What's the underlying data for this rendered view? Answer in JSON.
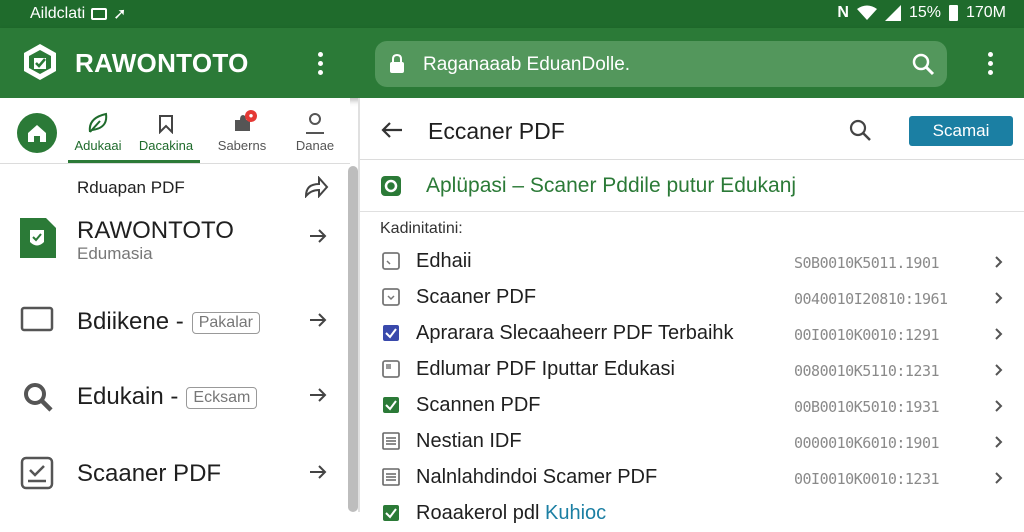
{
  "status_bar": {
    "left_text": "Aildclati",
    "battery": "15%",
    "time": "170M"
  },
  "app_bar": {
    "title": "RAWONTOTO",
    "search_text": "Raganaaab EduanDolle."
  },
  "left_panel": {
    "tabs": [
      {
        "label": "Adukaai",
        "active": true
      },
      {
        "label": "Dacakina",
        "active": true
      },
      {
        "label": "Saberns",
        "active": false
      },
      {
        "label": "Danae",
        "active": false
      }
    ],
    "list_header": "Rduapan PDF",
    "items": [
      {
        "title": "RAWONTOTO",
        "subtitle": "Edumasia",
        "icon": "document-shield-icon"
      },
      {
        "title": "Bdiikene -",
        "chip": "Pakalar",
        "icon": "tablet-icon"
      },
      {
        "title": "Edukain -",
        "chip": "Ecksam",
        "icon": "search-icon"
      },
      {
        "title": "Scaaner PDF",
        "icon": "scanner-icon"
      }
    ]
  },
  "right_panel": {
    "title": "Eccaner PDF",
    "scan_button": "Scamai",
    "subtitle": "Aplüpasi – Scaner Pddile putur Edukanj",
    "section_label": "Kadinitatini:",
    "documents": [
      {
        "name": "Edhaii",
        "id": "S0B0010K5011.1901",
        "state": "unchecked"
      },
      {
        "name": "Scaaner PDF",
        "id": "0040010I20810:1961",
        "state": "unchecked"
      },
      {
        "name": "Aprarara Slecaaheerr PDF Terbaihk",
        "id": "00I0010K0010:1291",
        "state": "checked-blue"
      },
      {
        "name": "Edlumar PDF Iputtar Edukasi",
        "id": "0080010K5110:1231",
        "state": "unchecked"
      },
      {
        "name": "Scannen PDF",
        "id": "00B0010K5010:1931",
        "state": "checked-green"
      },
      {
        "name": "Nestian IDF",
        "id": "0000010K6010:1901",
        "state": "list"
      },
      {
        "name": "Nalnlahdindoi Scamer PDF",
        "id": "00I0010K0010:1231",
        "state": "list"
      },
      {
        "name": "Roaakerol pdl",
        "link": "Kuhioc",
        "id": "",
        "state": "checked-green"
      }
    ]
  },
  "colors": {
    "primary": "#2b7a37",
    "status_bar": "#1f6b2c",
    "accent": "#1b7fa3",
    "checkbox_blue": "#3949ab"
  }
}
